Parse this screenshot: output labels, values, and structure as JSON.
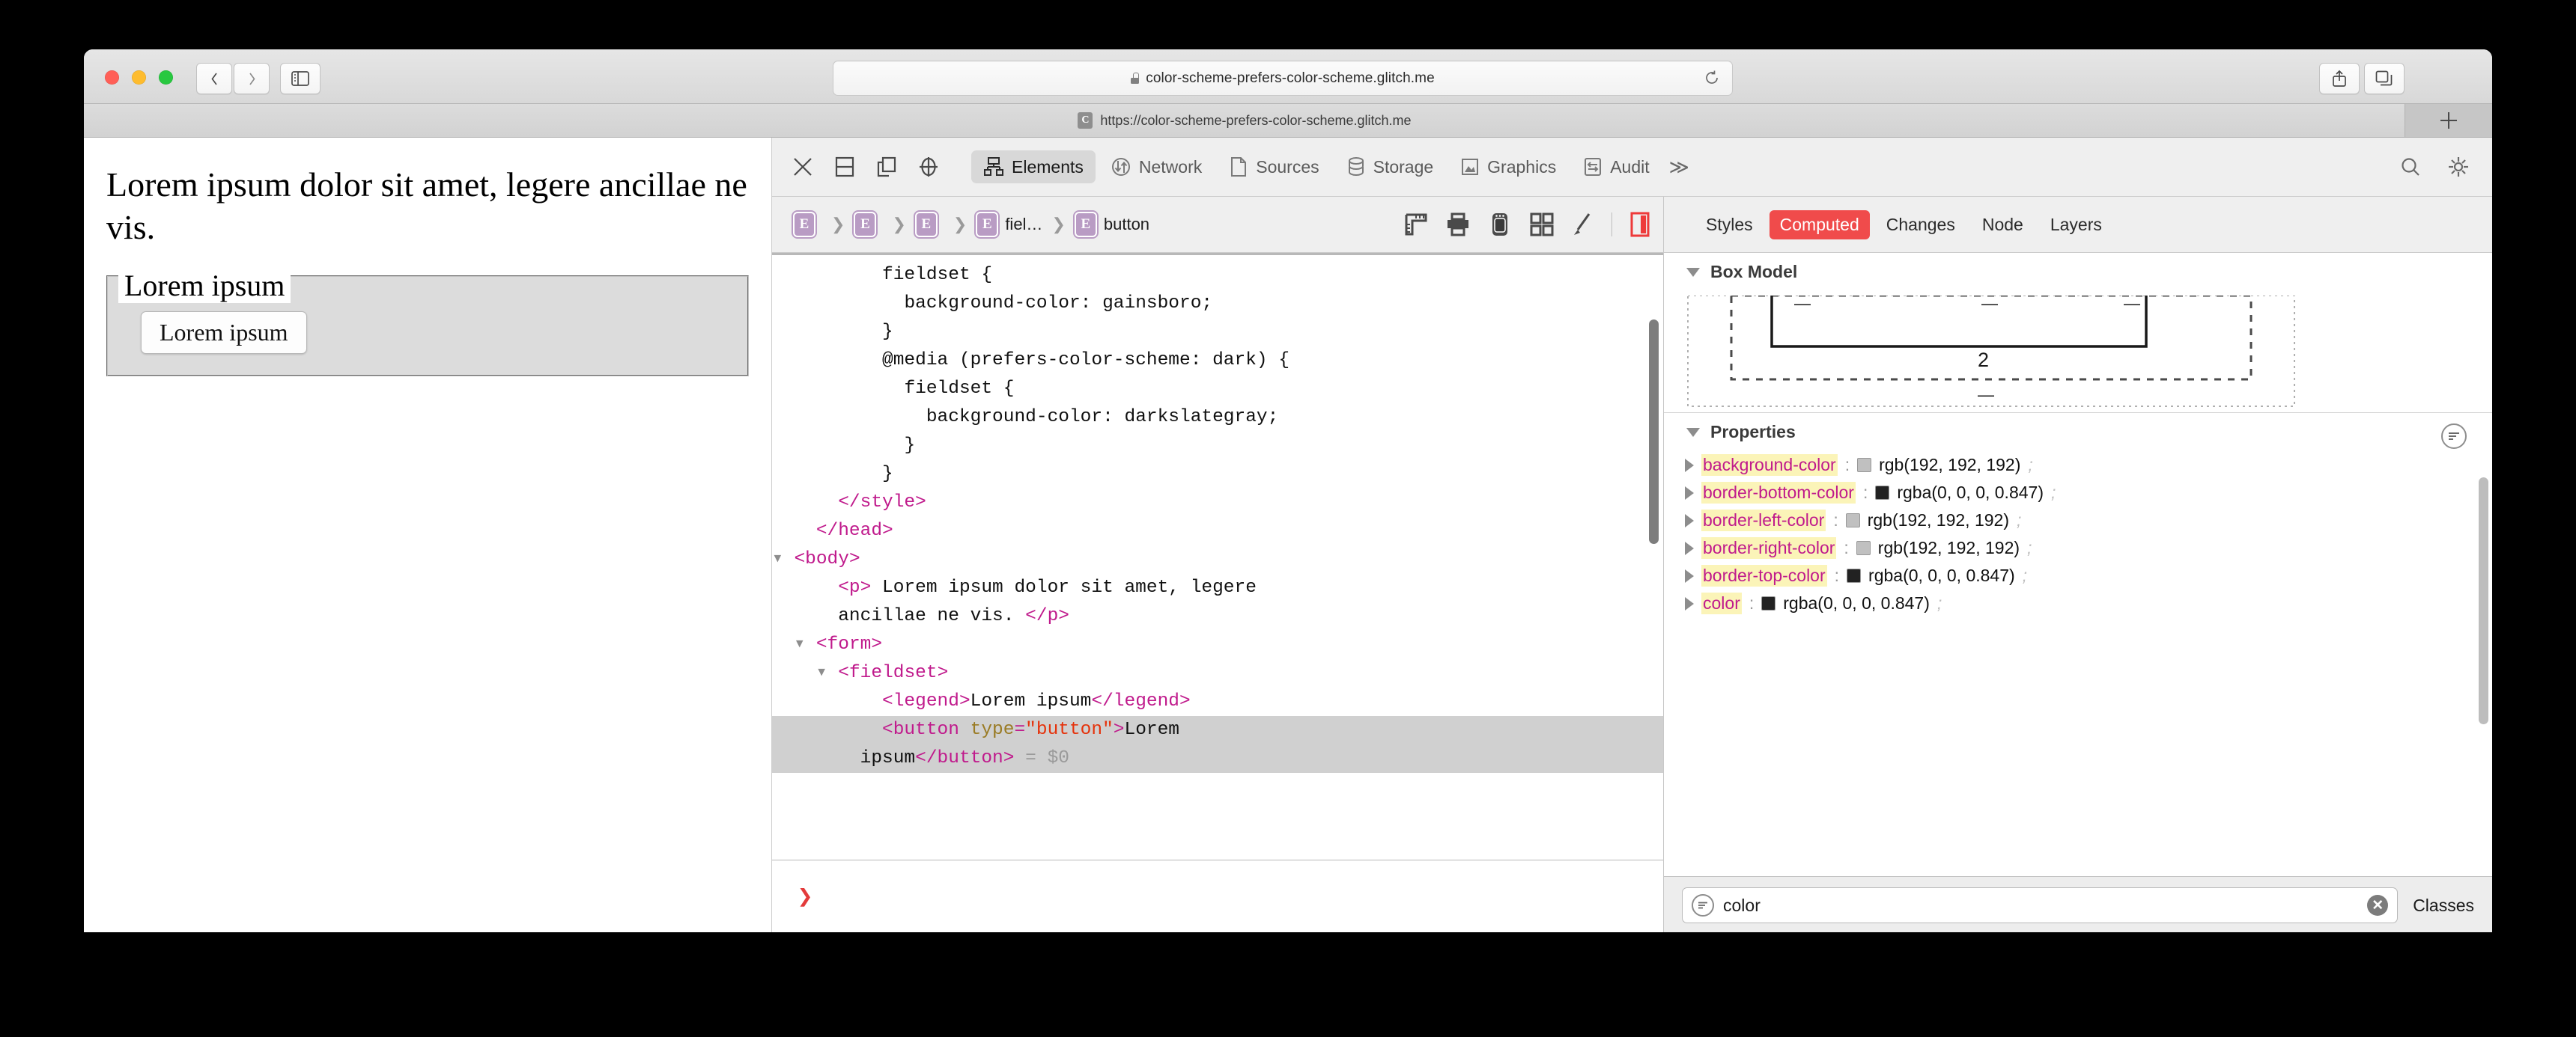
{
  "browser": {
    "url_display": "color-scheme-prefers-color-scheme.glitch.me",
    "tab_favicon_letter": "C",
    "tab_title": "https://color-scheme-prefers-color-scheme.glitch.me",
    "back_icon": "chevron-left-icon",
    "forward_icon": "chevron-right-icon",
    "sidebar_icon": "sidebar-icon",
    "share_icon": "share-icon",
    "tabs_overview_icon": "tab-overview-icon",
    "new_tab_icon": "plus-icon",
    "reload_icon": "reload-icon",
    "lock_icon": "lock-icon"
  },
  "page": {
    "paragraph": "Lorem ipsum dolor sit amet, legere ancillae ne vis.",
    "legend": "Lorem ipsum",
    "button_label": "Lorem ipsum"
  },
  "devtools": {
    "toolbar_icons": [
      "close-icon",
      "dock-bottom-icon",
      "dock-separate-window-icon",
      "inspect-target-icon"
    ],
    "tabs": [
      {
        "label": "Elements",
        "icon": "elements-tree-icon",
        "active": true
      },
      {
        "label": "Network",
        "icon": "network-arrows-icon",
        "active": false
      },
      {
        "label": "Sources",
        "icon": "document-icon",
        "active": false
      },
      {
        "label": "Storage",
        "icon": "database-icon",
        "active": false
      },
      {
        "label": "Graphics",
        "icon": "image-icon",
        "active": false
      },
      {
        "label": "Audit",
        "icon": "audit-arrows-icon",
        "active": false
      }
    ],
    "overflow_label": "≫",
    "search_icon": "search-icon",
    "settings_icon": "gear-icon",
    "breadcrumb": {
      "badge_letter": "E",
      "items": [
        {
          "label": ""
        },
        {
          "label": ""
        },
        {
          "label": ""
        },
        {
          "label": "fiel…"
        },
        {
          "label": "button"
        }
      ],
      "tool_icons": [
        "ruler-icon",
        "print-icon",
        "device-icon",
        "grid-icon",
        "paintbrush-icon",
        "layout-sidebar-icon"
      ]
    },
    "dom": {
      "lines": [
        {
          "indent": 5,
          "parts": [
            {
              "t": "txt",
              "s": "fieldset {"
            }
          ]
        },
        {
          "indent": 6,
          "parts": [
            {
              "t": "txt",
              "s": "background-color: gainsboro;"
            }
          ]
        },
        {
          "indent": 5,
          "parts": [
            {
              "t": "txt",
              "s": "}"
            }
          ]
        },
        {
          "indent": 5,
          "parts": [
            {
              "t": "txt",
              "s": "@media (prefers-color-scheme: dark) {"
            }
          ]
        },
        {
          "indent": 6,
          "parts": [
            {
              "t": "txt",
              "s": "fieldset {"
            }
          ]
        },
        {
          "indent": 7,
          "parts": [
            {
              "t": "txt",
              "s": "background-color: darkslategray;"
            }
          ]
        },
        {
          "indent": 6,
          "parts": [
            {
              "t": "txt",
              "s": "}"
            }
          ]
        },
        {
          "indent": 5,
          "parts": [
            {
              "t": "txt",
              "s": "}"
            }
          ]
        },
        {
          "indent": 3,
          "parts": [
            {
              "t": "tag",
              "s": "</style>"
            }
          ]
        },
        {
          "indent": 2,
          "parts": [
            {
              "t": "tag",
              "s": "</head>"
            }
          ]
        },
        {
          "indent": 1,
          "arrow": "down",
          "parts": [
            {
              "t": "tag",
              "s": "<body>"
            }
          ]
        },
        {
          "indent": 3,
          "parts": [
            {
              "t": "tag",
              "s": "<p>"
            },
            {
              "t": "txt",
              "s": " Lorem ipsum dolor sit amet, legere"
            }
          ]
        },
        {
          "indent": 3,
          "parts": [
            {
              "t": "txt",
              "s": "ancillae ne vis. "
            },
            {
              "t": "tag",
              "s": "</p>"
            }
          ]
        },
        {
          "indent": 2,
          "arrow": "down",
          "parts": [
            {
              "t": "tag",
              "s": "<form>"
            }
          ]
        },
        {
          "indent": 3,
          "arrow": "down",
          "parts": [
            {
              "t": "tag",
              "s": "<fieldset>"
            }
          ]
        },
        {
          "indent": 5,
          "parts": [
            {
              "t": "tag",
              "s": "<legend>"
            },
            {
              "t": "txt",
              "s": "Lorem ipsum"
            },
            {
              "t": "tag",
              "s": "</legend>"
            }
          ]
        },
        {
          "indent": 5,
          "selected": true,
          "parts": [
            {
              "t": "tag",
              "s": "<button "
            },
            {
              "t": "attr",
              "s": "type"
            },
            {
              "t": "tag",
              "s": "="
            },
            {
              "t": "val",
              "s": "\"button\""
            },
            {
              "t": "tag",
              "s": ">"
            },
            {
              "t": "txt",
              "s": "Lorem"
            }
          ]
        },
        {
          "indent": 4,
          "selected": true,
          "parts": [
            {
              "t": "txt",
              "s": "ipsum"
            },
            {
              "t": "tag",
              "s": "</button>"
            },
            {
              "t": "dim",
              "s": " = $0"
            }
          ]
        }
      ],
      "console_prompt": "❯"
    },
    "styles_panel": {
      "tabs": [
        {
          "label": "Styles",
          "active": false
        },
        {
          "label": "Computed",
          "active": true
        },
        {
          "label": "Changes",
          "active": false
        },
        {
          "label": "Node",
          "active": false
        },
        {
          "label": "Layers",
          "active": false
        }
      ],
      "box_model": {
        "title": "Box Model",
        "top_values": [
          "—",
          "—",
          "—"
        ],
        "center_value": "2",
        "bottom_value": "—"
      },
      "properties": {
        "title": "Properties",
        "filter_icon": "filter-icon",
        "items": [
          {
            "name": "background-color",
            "swatch": "#c0c0c0",
            "value": "rgb(192, 192, 192)",
            "semi": ";",
            "highlight": true
          },
          {
            "name": "border-bottom-color",
            "swatch": "#222222",
            "value": "rgba(0, 0, 0, 0.847)",
            "semi": ";",
            "highlight": true
          },
          {
            "name": "border-left-color",
            "swatch": "#c0c0c0",
            "value": "rgb(192, 192, 192)",
            "semi": ";",
            "highlight": true
          },
          {
            "name": "border-right-color",
            "swatch": "#c0c0c0",
            "value": "rgb(192, 192, 192)",
            "semi": ";",
            "highlight": true
          },
          {
            "name": "border-top-color",
            "swatch": "#222222",
            "value": "rgba(0, 0, 0, 0.847)",
            "semi": ";",
            "highlight": true
          },
          {
            "name": "color",
            "swatch": "#222222",
            "value": "rgba(0, 0, 0, 0.847)",
            "semi": ";",
            "highlight": true
          }
        ]
      },
      "filter": {
        "value": "color",
        "filter_icon": "filter-icon",
        "clear_icon": "clear-icon",
        "clear_label": "✕",
        "classes_label": "Classes"
      }
    }
  },
  "colors": {
    "accent_red": "#f04b4b",
    "tag_magenta": "#c01a8c",
    "attr_gold": "#9a7b24",
    "value_red": "#e5320b",
    "highlight_yellow": "#fbf4b8",
    "badge_purple": "#b99cc4"
  }
}
